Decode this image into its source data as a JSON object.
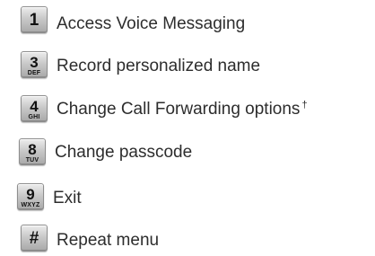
{
  "menu": {
    "items": [
      {
        "key_digit": "1",
        "key_letters": "",
        "key_icon": "key-1-icon",
        "label": "Access Voice Messaging",
        "footnote": ""
      },
      {
        "key_digit": "3",
        "key_letters": "DEF",
        "key_icon": "key-3-icon",
        "label": "Record personalized name",
        "footnote": ""
      },
      {
        "key_digit": "4",
        "key_letters": "GHI",
        "key_icon": "key-4-icon",
        "label": "Change Call Forwarding options",
        "footnote": "†"
      },
      {
        "key_digit": "8",
        "key_letters": "TUV",
        "key_icon": "key-8-icon",
        "label": "Change passcode",
        "footnote": ""
      },
      {
        "key_digit": "9",
        "key_letters": "WXYZ",
        "key_icon": "key-9-icon",
        "label": "Exit",
        "footnote": ""
      },
      {
        "key_digit": "#",
        "key_letters": "",
        "key_icon": "key-pound-icon",
        "label": "Repeat menu",
        "footnote": ""
      }
    ]
  }
}
